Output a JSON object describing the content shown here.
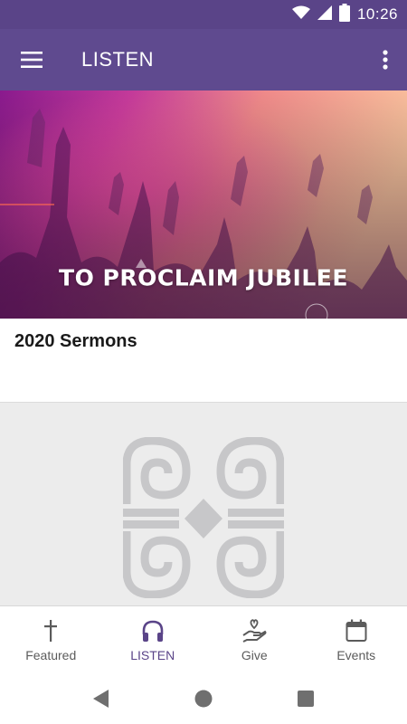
{
  "status_bar": {
    "time": "10:26",
    "icons": [
      "wifi-icon",
      "signal-icon",
      "battery-icon"
    ]
  },
  "app_bar": {
    "title": "LISTEN",
    "menu_icon": "hamburger-menu-icon",
    "more_icon": "more-vert-icon"
  },
  "banner": {
    "title": "TO PROCLAIM JUBILEE"
  },
  "card": {
    "title": "2020 Sermons"
  },
  "bottom_nav": {
    "items": [
      {
        "label": "Featured",
        "icon": "cross-icon",
        "active": false
      },
      {
        "label": "LISTEN",
        "icon": "headphones-icon",
        "active": true
      },
      {
        "label": "Give",
        "icon": "giving-hand-icon",
        "active": false
      },
      {
        "label": "Events",
        "icon": "calendar-icon",
        "active": false
      }
    ]
  },
  "system_nav": {
    "buttons": [
      "back-icon",
      "home-icon",
      "recents-icon"
    ]
  },
  "colors": {
    "primary": "#5f4a8f",
    "status_bar": "#5a4488",
    "active_nav": "#5a4488",
    "inactive_nav": "#5b5b5b",
    "placeholder_bg": "#ececec",
    "logo_gray": "#c7c7c9"
  }
}
